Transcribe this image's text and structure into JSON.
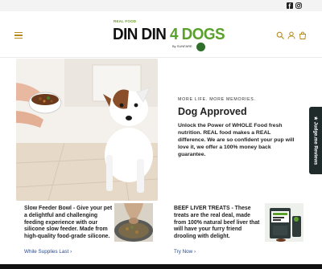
{
  "top_bar": {
    "social_icons": [
      "facebook-icon",
      "instagram-icon"
    ]
  },
  "header": {
    "logo": {
      "small_text": "REAL FOOD",
      "main_text_dark": "DIN DIN",
      "main_text_green": "4 DOGS",
      "sub_text": "By SUNFARE"
    },
    "icons": [
      "menu-icon",
      "search-icon",
      "user-icon",
      "bag-icon"
    ]
  },
  "hero": {
    "eyebrow": "MORE LIFE. MORE MEMORIES.",
    "title": "Dog Approved",
    "body": "Unlock the Power of WHOLE Food fresh nutrition. REAL food makes a REAL difference. We are so confident your pup will love it, we offer a 100% money back guarantee."
  },
  "judge_tab": {
    "label": "★ Judge.me Reviews"
  },
  "cards": [
    {
      "text": "Slow Feeder Bowl - Give your pet a delightful and challenging feeding experience with our silicone slow feeder. Made from high-quality food-grade silicone.",
      "link": "While Supplies Last"
    },
    {
      "text": "BEEF LIVER TREATS - These treats are the real deal, made from 100% natural beef liver that will have your furry friend drooling with delight.",
      "link": "Try Now"
    }
  ],
  "colors": {
    "accent": "#b58a1a",
    "brand_green": "#5aa12c",
    "link": "#2a4a8a",
    "tab": "#1f2a2a"
  }
}
